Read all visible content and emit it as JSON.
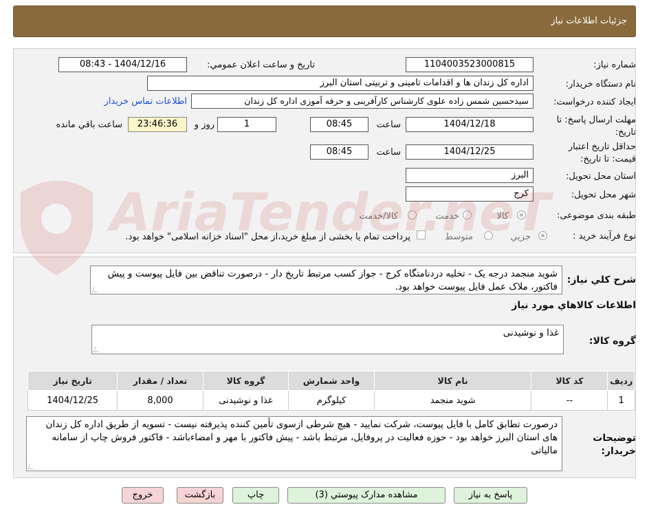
{
  "header": {
    "title": "جزئیات اطلاعات نیاز"
  },
  "form": {
    "need_number_label": "شماره نیاز:",
    "need_number": "1104003523000815",
    "announce_label": "تاریخ و ساعت اعلان عمومي:",
    "announce_value": "1404/12/16 - 08:43",
    "buyer_label": "نام دستگاه خریدار:",
    "buyer_value": "اداره کل زندان ها و اقدامات تامینی و تربیتی استان البرز",
    "creator_label": "ایجاد کننده درخواست:",
    "creator_value": "سیدحسین شمس زاده علوی کارشناس کارآفرینی و حرفه آموزی اداره کل زندان",
    "contact_link": "اطلاعات تماس خریدار",
    "deadline_label": "مهلت ارسال پاسخ: تا تاریخ:",
    "deadline_date": "1404/12/18",
    "time_label": "ساعت",
    "deadline_time": "08:45",
    "days_value": "1",
    "days_label": "روز و",
    "remaining_time": "23:46:36",
    "remaining_label": "ساعت باقي مانده",
    "validity_label": "حداقل تاریخ اعتبار قیمت: تا تاریخ:",
    "validity_date": "1404/12/25",
    "validity_time": "08:45",
    "province_label": "استان محل تحویل:",
    "province_value": "البرز",
    "city_label": "شهر محل تحویل:",
    "city_value": "کرج",
    "category_label": "طبقه بندی موضوعی:",
    "category_options": [
      "کالا",
      "خدمت",
      "کالا/خدمت"
    ],
    "process_label": "نوع فرآیند خرید :",
    "process_options": [
      "جزیي",
      "متوسط"
    ],
    "payment_note": "پرداخت تمام یا بخشی از مبلغ خرید،از محل \"اسناد خزانه اسلامی\" خواهد بود."
  },
  "details": {
    "general_label": "شرح کلي نیاز:",
    "general_value": "شوید منجمد درجه یک - تخلیه دردنامتگاه کرج - جواز کسب مرتبط تاریخ دار - درصورت تناقض بین فایل پیوست و پیش فاکتور، ملاک عمل فایل پیوست خواهد بود.",
    "goods_info_title": "اطلاعات کالاهاي مورد نیاز",
    "goods_group_label": "گروه کالا:",
    "goods_group_value": "غذا و نوشیدنی"
  },
  "table": {
    "headers": [
      "ردیف",
      "کد کالا",
      "نام کالا",
      "واحد شمارش",
      "گروه کالا",
      "تعداد / مقدار",
      "تاریخ نیاز"
    ],
    "rows": [
      [
        "1",
        "--",
        "شوید منجمد",
        "کیلوگرم",
        "غذا و نوشیدنی",
        "8,000",
        "1404/12/25"
      ]
    ]
  },
  "notes": {
    "label": "توضیحات خریدار:",
    "value": "درصورت تطابق کامل با فایل پیوست، شرکت نمایید - هیچ شرطی ازسوی تأمین کننده پذیرفته نیست - تسویه از طریق اداره کل زندان های استان البرز خواهد بود - حوزه فعالیت در پروفایل، مرتبط باشد - پیش فاکتور با مهر و امضاءباشد - فاکتور فروش چاپ از سامانه مالیاتی"
  },
  "buttons": {
    "reply": "پاسخ به نیاز",
    "docs": "مشاهده مدارک پیوستي (3)",
    "print": "چاپ",
    "back": "بازگشت",
    "exit": "خروج"
  },
  "watermark": {
    "text": "AriaTender.neT"
  },
  "colors": {
    "header": "#8a6a3d",
    "link": "#1a4fd6",
    "timer": "#fbf5c9",
    "button_green": "#dff3dc",
    "button_pink": "#f7d4d4"
  }
}
